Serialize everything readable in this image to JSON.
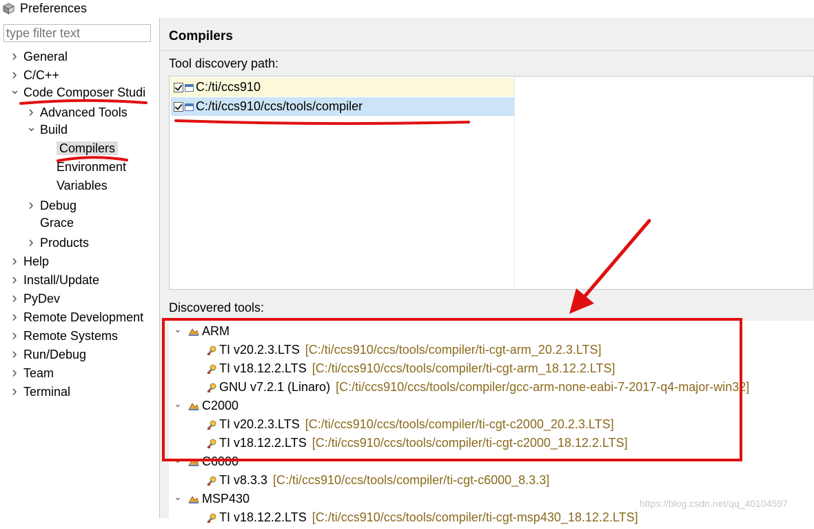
{
  "window": {
    "title": "Preferences"
  },
  "filter": {
    "placeholder": "type filter text"
  },
  "tree": [
    {
      "label": "General",
      "level": 0,
      "state": "collapsed"
    },
    {
      "label": "C/C++",
      "level": 0,
      "state": "collapsed"
    },
    {
      "label": "Code Composer Studi",
      "level": 0,
      "state": "expanded"
    },
    {
      "label": "Advanced Tools",
      "level": 1,
      "state": "collapsed"
    },
    {
      "label": "Build",
      "level": 1,
      "state": "expanded"
    },
    {
      "label": "Compilers",
      "level": 2,
      "state": "leaf",
      "selected": true
    },
    {
      "label": "Environment",
      "level": 2,
      "state": "leaf"
    },
    {
      "label": "Variables",
      "level": 2,
      "state": "leaf"
    },
    {
      "label": "Debug",
      "level": 1,
      "state": "collapsed"
    },
    {
      "label": "Grace",
      "level": 1,
      "state": "leaf"
    },
    {
      "label": "Products",
      "level": 1,
      "state": "collapsed"
    },
    {
      "label": "Help",
      "level": 0,
      "state": "collapsed"
    },
    {
      "label": "Install/Update",
      "level": 0,
      "state": "collapsed"
    },
    {
      "label": "PyDev",
      "level": 0,
      "state": "collapsed"
    },
    {
      "label": "Remote Development",
      "level": 0,
      "state": "collapsed"
    },
    {
      "label": "Remote Systems",
      "level": 0,
      "state": "collapsed"
    },
    {
      "label": "Run/Debug",
      "level": 0,
      "state": "collapsed"
    },
    {
      "label": "Team",
      "level": 0,
      "state": "collapsed"
    },
    {
      "label": "Terminal",
      "level": 0,
      "state": "collapsed"
    }
  ],
  "page": {
    "title": "Compilers",
    "discovery_label": "Tool discovery path:",
    "discovery_paths": [
      {
        "path": "C:/ti/ccs910",
        "checked": true
      },
      {
        "path": "C:/ti/ccs910/ccs/tools/compiler",
        "checked": true,
        "selected": true
      }
    ],
    "discovered_label": "Discovered tools:",
    "tool_groups": [
      {
        "name": "ARM",
        "tools": [
          {
            "name": "TI v20.2.3.LTS",
            "path": "[C:/ti/ccs910/ccs/tools/compiler/ti-cgt-arm_20.2.3.LTS]"
          },
          {
            "name": "TI v18.12.2.LTS",
            "path": "[C:/ti/ccs910/ccs/tools/compiler/ti-cgt-arm_18.12.2.LTS]"
          },
          {
            "name": "GNU v7.2.1 (Linaro)",
            "path": "[C:/ti/ccs910/ccs/tools/compiler/gcc-arm-none-eabi-7-2017-q4-major-win32]"
          }
        ]
      },
      {
        "name": "C2000",
        "tools": [
          {
            "name": "TI v20.2.3.LTS",
            "path": "[C:/ti/ccs910/ccs/tools/compiler/ti-cgt-c2000_20.2.3.LTS]"
          },
          {
            "name": "TI v18.12.2.LTS",
            "path": "[C:/ti/ccs910/ccs/tools/compiler/ti-cgt-c2000_18.12.2.LTS]"
          }
        ]
      },
      {
        "name": "C6000",
        "tools": [
          {
            "name": "TI v8.3.3",
            "path": "[C:/ti/ccs910/ccs/tools/compiler/ti-cgt-c6000_8.3.3]"
          }
        ]
      },
      {
        "name": "MSP430",
        "tools": [
          {
            "name": "TI v18.12.2.LTS",
            "path": "[C:/ti/ccs910/ccs/tools/compiler/ti-cgt-msp430_18.12.2.LTS]"
          }
        ]
      }
    ]
  },
  "watermark": "https://blog.csdn.net/qq_40104597",
  "colors": {
    "annotation": "#e01010",
    "path_text": "#8b6a1c",
    "selection": "#cce4f7",
    "highlight_row": "#fbf9d9"
  }
}
